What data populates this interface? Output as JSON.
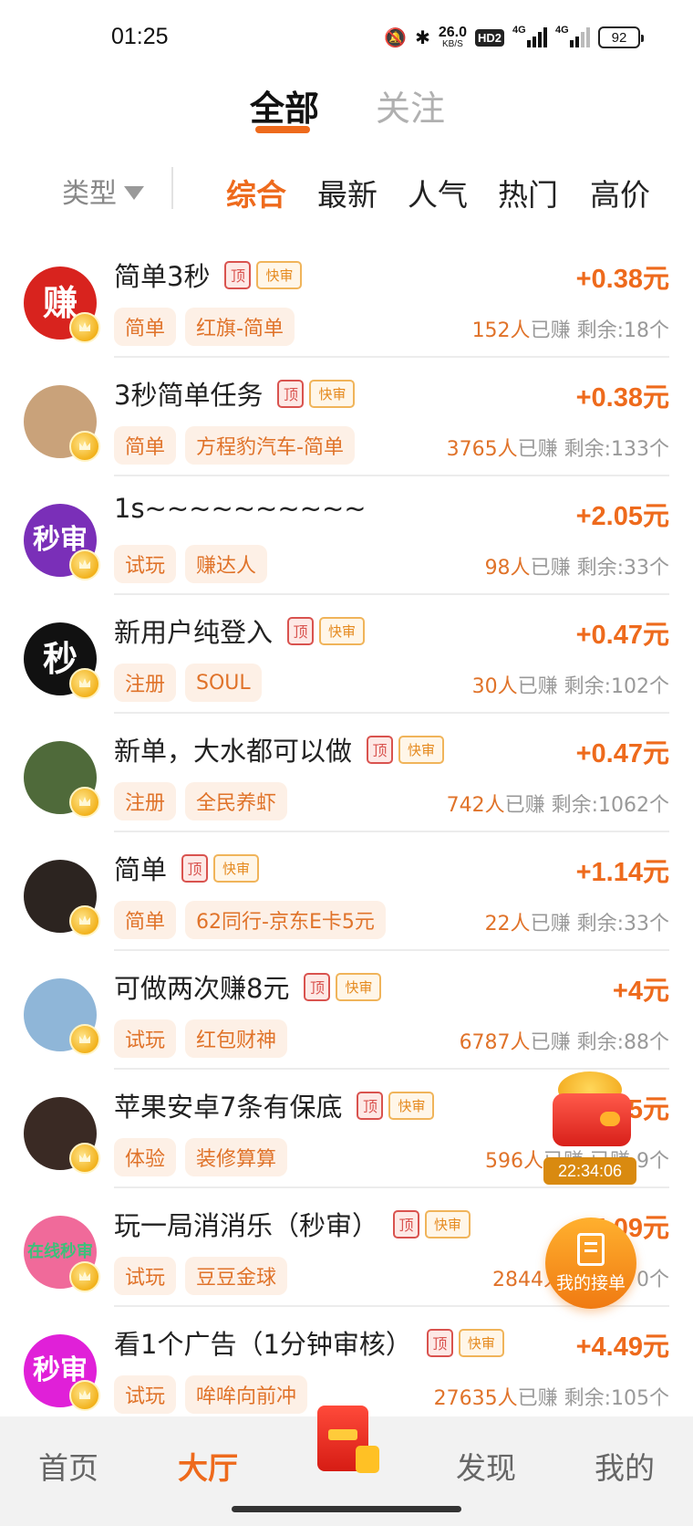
{
  "status": {
    "time": "01:25",
    "net_speed": "26.0",
    "net_unit": "KB/S",
    "hd": "HD2",
    "net1": "4G",
    "net2": "4G",
    "battery": "92"
  },
  "top_tabs": [
    {
      "label": "全部",
      "active": true
    },
    {
      "label": "关注",
      "active": false
    }
  ],
  "filter": {
    "type_label": "类型",
    "sorts": [
      {
        "label": "综合",
        "active": true
      },
      {
        "label": "最新"
      },
      {
        "label": "人气"
      },
      {
        "label": "热门"
      },
      {
        "label": "高价"
      }
    ]
  },
  "badges": {
    "top": "顶",
    "fast": "快审"
  },
  "earned_suffix": "已赚",
  "tasks": [
    {
      "title": "简单3秒",
      "badges": true,
      "price": "+0.38元",
      "tags": [
        "简单",
        "红旗-简单"
      ],
      "earned_count": "152人",
      "remaining": "剩余:18个",
      "avatar_text": "赚",
      "avatar_color": "#d8231e"
    },
    {
      "title": "3秒简单任务",
      "badges": true,
      "price": "+0.38元",
      "tags": [
        "简单",
        "方程豹汽车-简单"
      ],
      "earned_count": "3765人",
      "remaining": "剩余:133个",
      "avatar_text": "",
      "avatar_color": "#c9a27a"
    },
    {
      "title": "1s~~~~~~~~~~",
      "badges": false,
      "price": "+2.05元",
      "tags": [
        "试玩",
        "赚达人"
      ],
      "earned_count": "98人",
      "remaining": "剩余:33个",
      "avatar_text": "秒审",
      "avatar_color": "#7a2fb8"
    },
    {
      "title": "新用户纯登入",
      "badges": true,
      "price": "+0.47元",
      "tags": [
        "注册",
        "SOUL"
      ],
      "earned_count": "30人",
      "remaining": "剩余:102个",
      "avatar_text": "秒",
      "avatar_color": "#111111"
    },
    {
      "title": "新单，大水都可以做",
      "badges": true,
      "price": "+0.47元",
      "tags": [
        "注册",
        "全民养虾"
      ],
      "earned_count": "742人",
      "remaining": "剩余:1062个",
      "avatar_text": "",
      "avatar_color": "#4f6a3a"
    },
    {
      "title": "简单",
      "badges": true,
      "price": "+1.14元",
      "tags": [
        "简单",
        "62同行-京东E卡5元"
      ],
      "earned_count": "22人",
      "remaining": "剩余:33个",
      "avatar_text": "",
      "avatar_color": "#2c2420"
    },
    {
      "title": "可做两次赚8元",
      "badges": true,
      "price": "+4元",
      "tags": [
        "试玩",
        "红包财神"
      ],
      "earned_count": "6787人",
      "remaining": "剩余:88个",
      "avatar_text": "",
      "avatar_color": "#8fb6d8"
    },
    {
      "title": "苹果安卓7条有保底",
      "badges": true,
      "price": "5元",
      "tags": [
        "体验",
        "装修算算"
      ],
      "earned_count": "596人",
      "remaining": "已赚 9个",
      "avatar_text": "",
      "avatar_color": "#3a2a24"
    },
    {
      "title": "玩一局消消乐（秒审）",
      "badges": true,
      "price": "5.09元",
      "tags": [
        "试玩",
        "豆豆金球"
      ],
      "earned_count": "2844人",
      "remaining": "已 0个",
      "avatar_text": "在线秒审",
      "avatar_color": "#f06a9a"
    },
    {
      "title": "看1个广告（1分钟审核）",
      "badges": true,
      "price": "+4.49元",
      "tags": [
        "试玩",
        "哞哞向前冲"
      ],
      "earned_count": "27635人",
      "remaining": "剩余:105个",
      "avatar_text": "秒审",
      "avatar_color": "#e020d8"
    }
  ],
  "floating": {
    "countdown": "22:34:06",
    "my_orders": "我的接单"
  },
  "bottom_nav": [
    {
      "label": "首页",
      "active": false
    },
    {
      "label": "大厅",
      "active": true
    },
    {
      "label": "发现",
      "active": false
    },
    {
      "label": "我的",
      "active": false
    }
  ]
}
